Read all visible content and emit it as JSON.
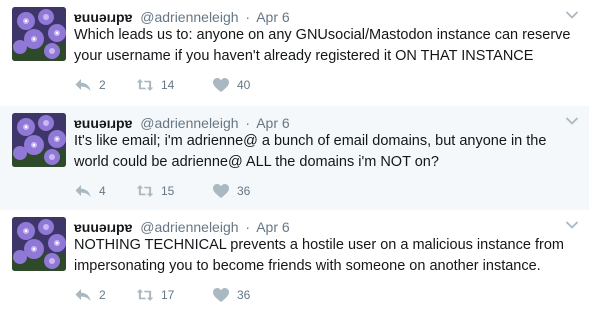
{
  "tweets": [
    {
      "name": "ɐuuǝıɹpɐ",
      "handle": "@adrienneleigh",
      "separator": "·",
      "time": "Apr 6",
      "text": "Which leads us to: anyone on any GNUsocial/Mastodon instance can reserve your username if you haven't already registered it ON THAT INSTANCE",
      "replies": "2",
      "retweets": "14",
      "likes": "40"
    },
    {
      "name": "ɐuuǝıɹpɐ",
      "handle": "@adrienneleigh",
      "separator": "·",
      "time": "Apr 6",
      "text": "It's like email; i'm adrienne@ a bunch of email domains, but anyone in the world could be adrienne@ ALL the domains i'm NOT on?",
      "replies": "4",
      "retweets": "15",
      "likes": "36"
    },
    {
      "name": "ɐuuǝıɹpɐ",
      "handle": "@adrienneleigh",
      "separator": "·",
      "time": "Apr 6",
      "text": "NOTHING TECHNICAL prevents a hostile user on a malicious instance from impersonating you to become friends with someone on another instance.",
      "replies": "2",
      "retweets": "17",
      "likes": "36"
    }
  ],
  "icons": {
    "reply": "reply-icon",
    "retweet": "retweet-icon",
    "like": "heart-icon",
    "more": "chevron-down-icon"
  },
  "colors": {
    "text": "#14171a",
    "meta": "#657786",
    "action": "#aab8c2",
    "thread_line": "#ccd6dd",
    "hover_bg": "#f5f8fa"
  }
}
